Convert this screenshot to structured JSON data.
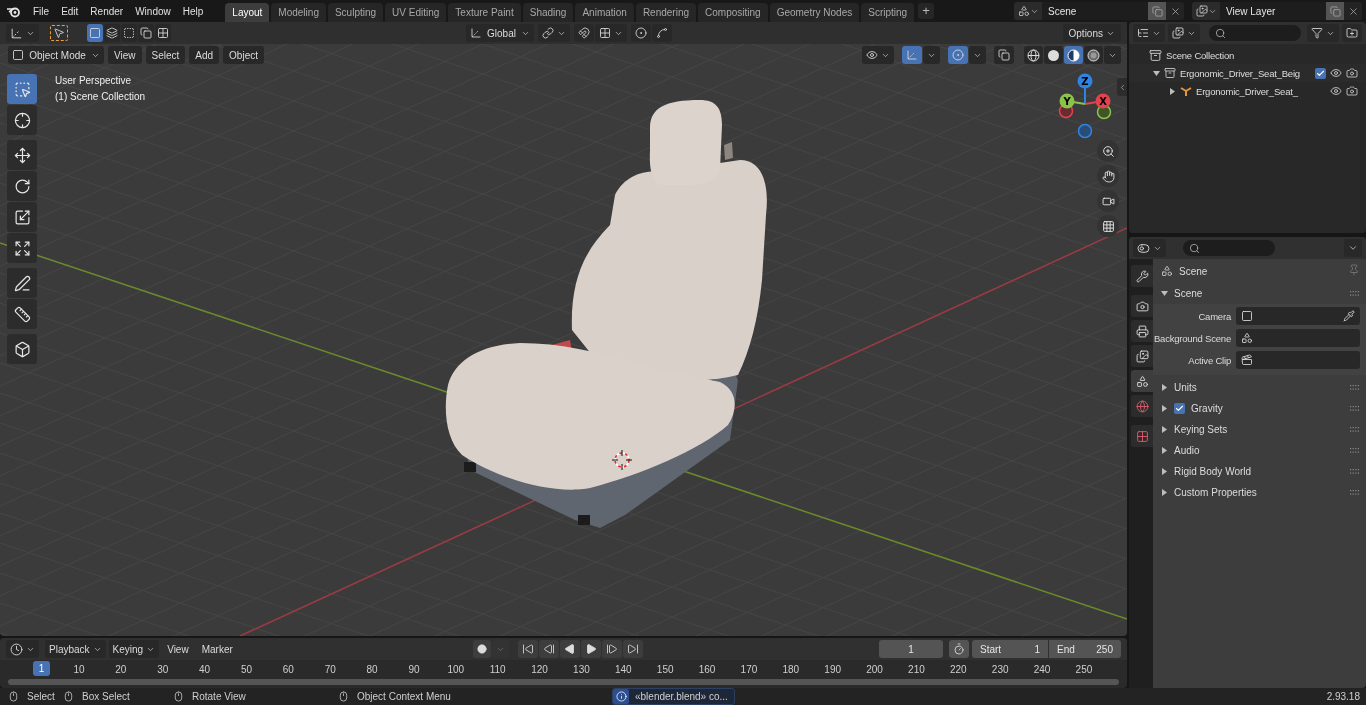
{
  "topbar": {
    "menus": [
      "File",
      "Edit",
      "Render",
      "Window",
      "Help"
    ],
    "workspaces": [
      {
        "label": "Layout",
        "selected": true
      },
      {
        "label": "Modeling",
        "selected": false
      },
      {
        "label": "Sculpting",
        "selected": false
      },
      {
        "label": "UV Editing",
        "selected": false
      },
      {
        "label": "Texture Paint",
        "selected": false
      },
      {
        "label": "Shading",
        "selected": false
      },
      {
        "label": "Animation",
        "selected": false
      },
      {
        "label": "Rendering",
        "selected": false
      },
      {
        "label": "Compositing",
        "selected": false
      },
      {
        "label": "Geometry Nodes",
        "selected": false
      },
      {
        "label": "Scripting",
        "selected": false
      }
    ],
    "add_workspace": "+",
    "scene": "Scene",
    "view_layer": "View Layer"
  },
  "viewport": {
    "select_modes": [
      {
        "kind": "set",
        "selected": true
      },
      {
        "kind": "extend",
        "selected": false
      },
      {
        "kind": "subtract",
        "selected": false
      },
      {
        "kind": "difference",
        "selected": false
      },
      {
        "kind": "intersect",
        "selected": false
      }
    ],
    "orientation": "Global",
    "options": "Options",
    "mode": "Object Mode",
    "menus": [
      "View",
      "Select",
      "Add",
      "Object"
    ],
    "toggles": [
      {
        "kind": "gizmos",
        "on": true
      },
      {
        "kind": "overlays",
        "on": true
      },
      {
        "kind": "xray",
        "on": false
      }
    ],
    "shading": [
      {
        "kind": "wireframe",
        "selected": false
      },
      {
        "kind": "solid",
        "selected": false
      },
      {
        "kind": "material",
        "selected": true
      },
      {
        "kind": "rendered",
        "selected": false
      }
    ],
    "info": [
      "User Perspective",
      "(1) Scene Collection"
    ],
    "tool_groups": [
      [
        {
          "kind": "select",
          "selected": true
        },
        {
          "kind": "cursor",
          "selected": false
        }
      ],
      [
        {
          "kind": "move",
          "selected": false
        },
        {
          "kind": "rotate",
          "selected": false
        },
        {
          "kind": "scale",
          "selected": false
        },
        {
          "kind": "transform",
          "selected": false
        }
      ],
      [
        {
          "kind": "annotate",
          "selected": false
        },
        {
          "kind": "measure",
          "selected": false
        }
      ],
      [
        {
          "kind": "add_cube",
          "selected": false
        }
      ]
    ],
    "gizmo": [
      {
        "label": "Z",
        "color": "#2f84e3"
      },
      {
        "label": "Y",
        "color": "#8bc34a"
      },
      {
        "label": "X",
        "color": "#e5414e"
      }
    ],
    "nav_buttons": [
      {
        "kind": "zoom"
      },
      {
        "kind": "pan"
      },
      {
        "kind": "camera"
      },
      {
        "kind": "ortho"
      }
    ]
  },
  "outliner": {
    "root": "Scene Collection",
    "items": [
      {
        "label": "Ergonomic_Driver_Seat_Beig",
        "kind": "collection",
        "expanded": true,
        "checked": true,
        "children": [
          {
            "label": "Ergonomic_Driver_Seat_",
            "kind": "object",
            "expanded": false
          }
        ]
      }
    ]
  },
  "properties": {
    "tab_groups": [
      [
        {
          "kind": "tool",
          "selected": false
        }
      ],
      [
        {
          "kind": "render",
          "selected": false
        },
        {
          "kind": "output",
          "selected": false
        },
        {
          "kind": "view_layer",
          "selected": false
        },
        {
          "kind": "scene",
          "selected": true
        },
        {
          "kind": "world",
          "selected": false
        }
      ],
      [
        {
          "kind": "texture",
          "selected": false
        }
      ]
    ],
    "context": "Scene",
    "panels": [
      {
        "title": "Scene",
        "expanded": true,
        "fields": [
          {
            "label": "Camera",
            "kind": "camera"
          },
          {
            "label": "Background Scene",
            "kind": "scene"
          },
          {
            "label": "Active Clip",
            "kind": "clip"
          }
        ]
      },
      {
        "title": "Units",
        "expanded": false
      },
      {
        "title": "Gravity",
        "expanded": false,
        "checked": true
      },
      {
        "title": "Keying Sets",
        "expanded": false
      },
      {
        "title": "Audio",
        "expanded": false
      },
      {
        "title": "Rigid Body World",
        "expanded": false
      },
      {
        "title": "Custom Properties",
        "expanded": false
      }
    ]
  },
  "timeline": {
    "menus": [
      {
        "label": "Playback",
        "kind": "dropdown"
      },
      {
        "label": "Keying",
        "kind": "dropdown"
      },
      {
        "label": "View",
        "kind": "menu"
      },
      {
        "label": "Marker",
        "kind": "menu"
      }
    ],
    "current_frame": "1",
    "start": {
      "label": "Start",
      "value": "1"
    },
    "end": {
      "label": "End",
      "value": "250"
    },
    "playhead": "1",
    "ticks": [
      "10",
      "20",
      "30",
      "40",
      "50",
      "60",
      "70",
      "80",
      "90",
      "100",
      "110",
      "120",
      "130",
      "140",
      "150",
      "160",
      "170",
      "180",
      "190",
      "200",
      "210",
      "220",
      "230",
      "240",
      "250"
    ]
  },
  "status_bar": {
    "hints": [
      "Select",
      "Box Select",
      "Rotate View",
      "Object Context Menu"
    ],
    "report": "«blender.blend» co...",
    "version": "2.93.18"
  }
}
